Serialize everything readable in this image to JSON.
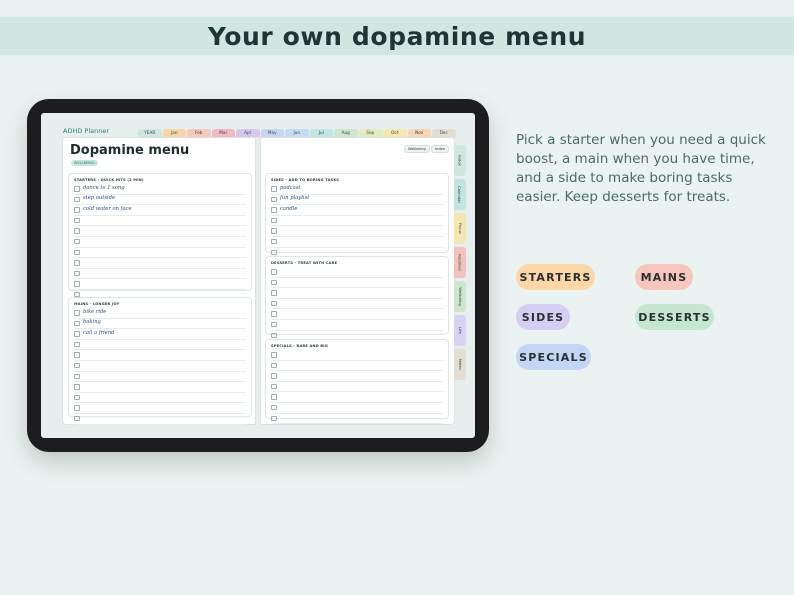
{
  "banner": {
    "title": "Your own dopamine menu"
  },
  "tablet": {
    "brand": "ADHD Planner",
    "month_tabs": [
      {
        "label": "YEAR",
        "color": "#cfe6e1"
      },
      {
        "label": "Jan",
        "color": "#f8d4a6"
      },
      {
        "label": "Feb",
        "color": "#f6c9b9"
      },
      {
        "label": "Mar",
        "color": "#f4b9c0"
      },
      {
        "label": "Apr",
        "color": "#d9c6ef"
      },
      {
        "label": "May",
        "color": "#c9d4f4"
      },
      {
        "label": "Jun",
        "color": "#c3dcf2"
      },
      {
        "label": "Jul",
        "color": "#c2e4e2"
      },
      {
        "label": "Aug",
        "color": "#cde7cf"
      },
      {
        "label": "Sep",
        "color": "#e2ecc2"
      },
      {
        "label": "Oct",
        "color": "#f5e7ad"
      },
      {
        "label": "Nov",
        "color": "#f6d4b4"
      },
      {
        "label": "Dec",
        "color": "#e4ddd2"
      }
    ],
    "title": "Dopamine menu",
    "title_badge": "WELLBEING",
    "top_pills": [
      "Wellbeing",
      "Index"
    ],
    "sections": {
      "starters": {
        "head": "STARTERS - QUICK HITS (2 MIN)",
        "items": [
          "dance to 1 song",
          "step outside",
          "cold water on face"
        ]
      },
      "mains": {
        "head": "MAINS - LONGER JOY",
        "items": [
          "bike ride",
          "baking",
          "call a friend"
        ]
      },
      "sides": {
        "head": "SIDES - ADD TO BORING TASKS",
        "items": [
          "podcast",
          "fun playlist",
          "candle"
        ]
      },
      "desserts": {
        "head": "DESSERTS - TREAT WITH CARE",
        "items": []
      },
      "specials": {
        "head": "SPECIALS - RARE AND BIG",
        "items": []
      }
    },
    "side_tabs": [
      {
        "label": "Index",
        "color": "#cfe6e1"
      },
      {
        "label": "Calendar",
        "color": "#c2e4e2"
      },
      {
        "label": "Focus",
        "color": "#f5e7ad"
      },
      {
        "label": "Routines",
        "color": "#f4c2bd"
      },
      {
        "label": "Wellbeing",
        "color": "#cde7cf"
      },
      {
        "label": "Life",
        "color": "#d9d2f2"
      },
      {
        "label": "Notes",
        "color": "#e4ddd2"
      }
    ]
  },
  "description": "Pick a starter when you need a quick boost, a main when you have time, and a side to make boring tasks easier. Keep desserts for treats.",
  "categories": [
    {
      "label": "STARTERS",
      "color": "#fbd7a8"
    },
    {
      "label": "MAINS",
      "color": "#f7c6bd"
    },
    {
      "label": "SIDES",
      "color": "#d6cdf2"
    },
    {
      "label": "DESSERTS",
      "color": "#c5e6cf"
    },
    {
      "label": "SPECIALS",
      "color": "#c3d6f4"
    }
  ]
}
